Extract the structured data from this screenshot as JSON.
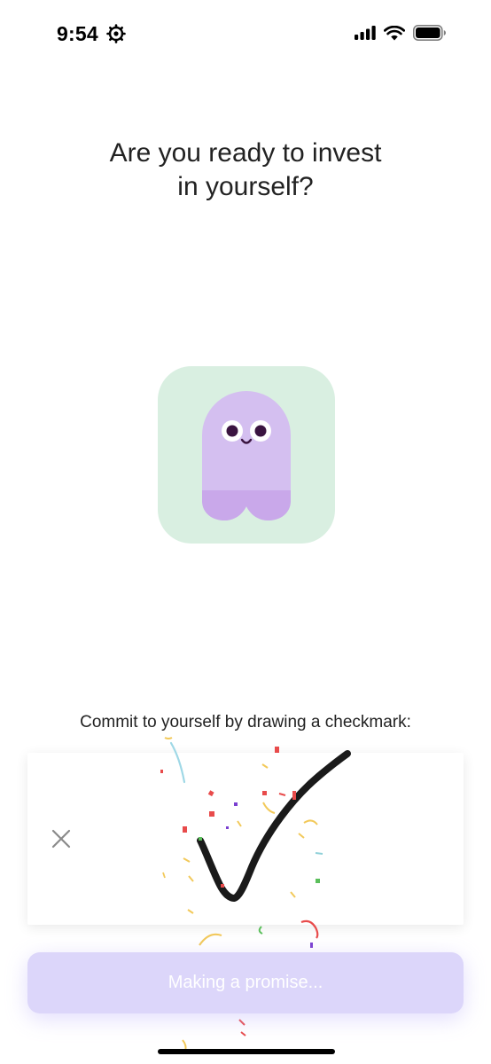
{
  "status_bar": {
    "time": "9:54",
    "icons": [
      "gear-icon",
      "signal-icon",
      "wifi-icon",
      "battery-icon"
    ]
  },
  "onboarding": {
    "title_line1": "Are you ready to invest",
    "title_line2": "in yourself?",
    "mascot": "purple-ghost-icon",
    "instruction": "Commit to yourself by drawing a checkmark:",
    "button_label": "Making a promise..."
  },
  "colors": {
    "mascot_tile_bg": "#d9efe1",
    "mascot_body": "#d4bff0",
    "mascot_skirt": "#c9a8ea",
    "button_bg": "#dcd6fa",
    "ink": "#1a1a1a"
  }
}
